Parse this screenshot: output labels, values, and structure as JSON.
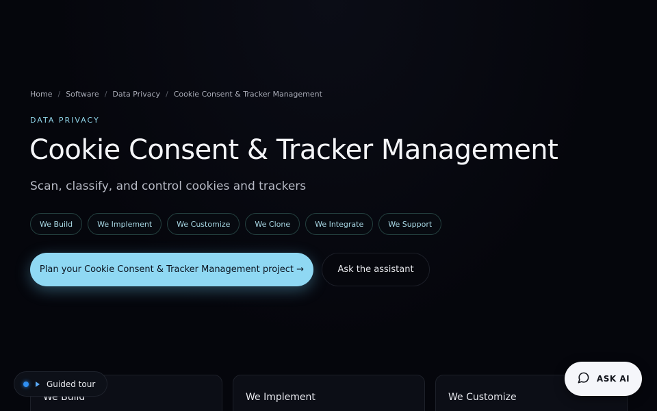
{
  "breadcrumb": {
    "items": [
      "Home",
      "Software",
      "Data Privacy",
      "Cookie Consent & Tracker Management"
    ],
    "separator": "/"
  },
  "hero": {
    "eyebrow": "DATA PRIVACY",
    "title": "Cookie Consent & Tracker Management",
    "subtitle": "Scan, classify, and control cookies and trackers"
  },
  "chips": [
    {
      "label": "We Build"
    },
    {
      "label": "We Implement"
    },
    {
      "label": "We Customize"
    },
    {
      "label": "We Clone"
    },
    {
      "label": "We Integrate"
    },
    {
      "label": "We Support"
    }
  ],
  "cta": {
    "primary_label": "Plan your Cookie Consent & Tracker Management project →",
    "secondary_label": "Ask the assistant"
  },
  "cards": [
    {
      "title": "We Build"
    },
    {
      "title": "We Implement"
    },
    {
      "title": "We Customize"
    }
  ],
  "tour": {
    "label": "Guided tour",
    "icon": "play-icon"
  },
  "ask_ai": {
    "label": "ASK AI",
    "icon": "chat-bubble-icon"
  },
  "colors": {
    "background": "#05060c",
    "accent": "#8fd8f3",
    "eyebrow": "#8fd3e8",
    "tour_dot": "#2f8ff3"
  }
}
